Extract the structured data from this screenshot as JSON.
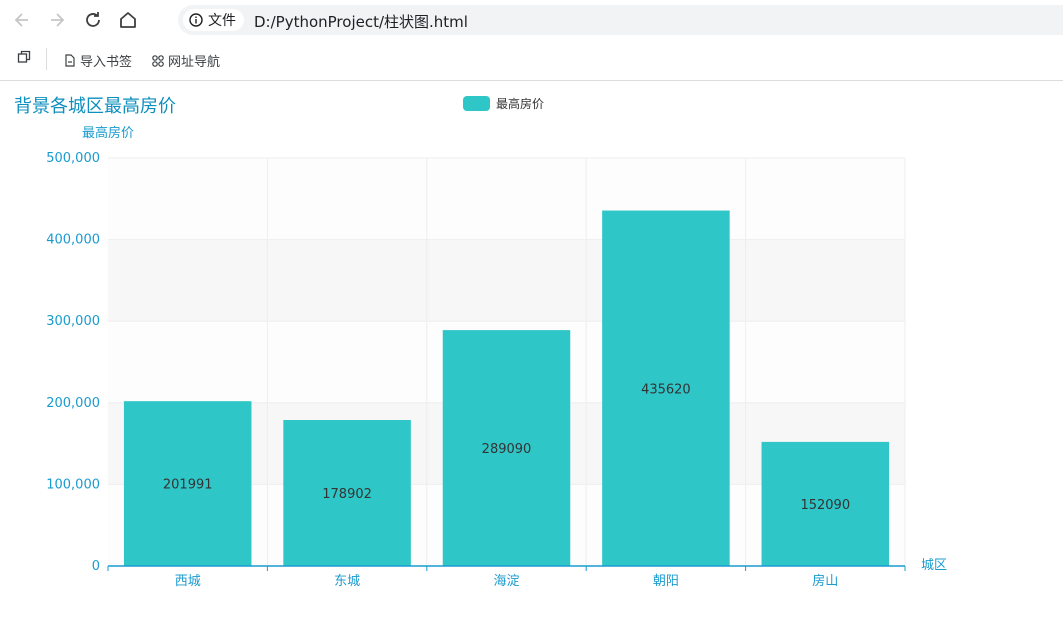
{
  "browser": {
    "info_label": "文件",
    "url": "D:/PythonProject/柱状图.html",
    "bookmarks": [
      {
        "label": "导入书签",
        "icon": "doc-icon"
      },
      {
        "label": "网址导航",
        "icon": "grid-icon"
      }
    ]
  },
  "colors": {
    "bar": "#2fc6c8",
    "axis": "#1a9bd0",
    "title": "#0e8fc0"
  },
  "chart_data": {
    "type": "bar",
    "title": "背景各城区最高房价",
    "legend": [
      "最高房价"
    ],
    "legend_position": "top-center",
    "xlabel": "城区",
    "ylabel": "最高房价",
    "categories": [
      "西城",
      "东城",
      "海淀",
      "朝阳",
      "房山"
    ],
    "series": [
      {
        "name": "最高房价",
        "values": [
          201991,
          178902,
          289090,
          435620,
          152090
        ]
      }
    ],
    "ylim": [
      0,
      500000
    ],
    "yticks": [
      "0",
      "100,000",
      "200,000",
      "300,000",
      "400,000",
      "500,000"
    ],
    "grid": true,
    "show_values": true
  }
}
